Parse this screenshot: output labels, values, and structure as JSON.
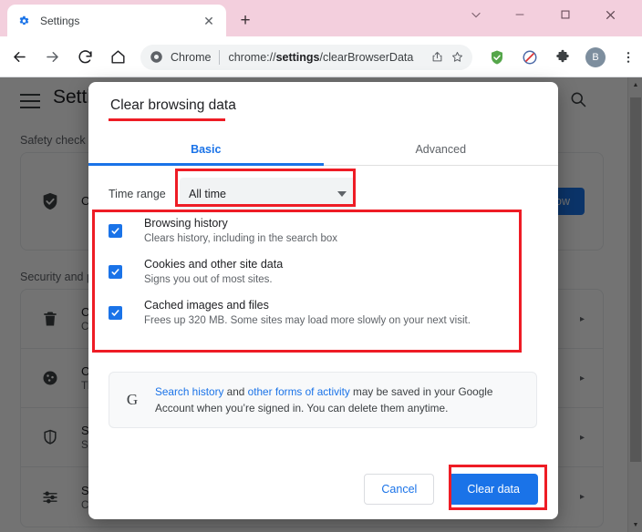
{
  "browser": {
    "tab": {
      "favicon": "gear-icon",
      "title": "Settings",
      "close": "✕"
    },
    "new_tab": "+",
    "window_controls": {
      "chevron": "⌄",
      "minimize": "–",
      "maximize": "□",
      "close": "✕"
    },
    "toolbar": {
      "back": "←",
      "forward": "→",
      "reload": "↻",
      "home": "⌂",
      "omnibox": {
        "site_icon": "chrome-icon",
        "site_label": "Chrome",
        "url_prefix": "chrome://",
        "url_bold": "settings",
        "url_suffix": "/clearBrowserData",
        "share": "share-icon",
        "bookmark": "☆"
      },
      "extensions": [
        {
          "name": "adguard-shield-icon",
          "color": "#55a64a"
        },
        {
          "name": "adblock-icon",
          "color": "#4e6ba8"
        },
        {
          "name": "puzzle-extensions-icon",
          "color": "#3c4043"
        }
      ],
      "avatar_letter": "B",
      "menu": "⋮"
    }
  },
  "settings_page": {
    "menu_button": "hamburger-icon",
    "heading": "Settings",
    "search": "search-icon",
    "sections": [
      {
        "label": "Safety check"
      },
      {
        "label": "Security and privacy"
      }
    ],
    "safety_card": {
      "icon": "safety-shield-icon",
      "title": "Chrome can help keep you safe from data breaches, bad extensions, and more",
      "button": "Check now"
    },
    "rows": [
      {
        "icon": "trash-icon",
        "title": "Clear browsing data",
        "sub": "Clear history, cookies, cache, and more",
        "arrow": "▸"
      },
      {
        "icon": "cookie-icon",
        "title": "Cookies and other site data",
        "sub": "Third-party cookies are blocked in Incognito mode",
        "arrow": "▸"
      },
      {
        "icon": "shield-icon",
        "title": "Security",
        "sub": "Safe Browsing (protection from dangerous sites) and other security settings",
        "arrow": "▸"
      },
      {
        "icon": "sliders-icon",
        "title": "Site Settings",
        "sub": "Controls what information sites can use and show",
        "arrow": "▸"
      }
    ],
    "scrollbar": {
      "up": "▲",
      "down": "▼"
    }
  },
  "dialog": {
    "title": "Clear browsing data",
    "tabs": [
      {
        "label": "Basic",
        "active": true
      },
      {
        "label": "Advanced",
        "active": false
      }
    ],
    "time_range": {
      "label": "Time range",
      "value": "All time",
      "caret": "caret-down-icon"
    },
    "checkboxes": [
      {
        "checked": true,
        "title": "Browsing history",
        "sub": "Clears history, including in the search box"
      },
      {
        "checked": true,
        "title": "Cookies and other site data",
        "sub": "Signs you out of most sites."
      },
      {
        "checked": true,
        "title": "Cached images and files",
        "sub": "Frees up 320 MB. Some sites may load more slowly on your next visit."
      }
    ],
    "google_note": {
      "icon": "google-g-icon",
      "link1": "Search history",
      "mid1": " and ",
      "link2": "other forms of activity",
      "rest": " may be saved in your Google Account when you’re signed in. You can delete them anytime."
    },
    "buttons": {
      "cancel": "Cancel",
      "confirm": "Clear data"
    }
  },
  "annotations": {
    "color": "#ee1c25",
    "targets": [
      "dialog-title-underline",
      "time-range-select",
      "checkbox-group",
      "clear-data-button"
    ]
  },
  "colors": {
    "accent_blue": "#1a73e8",
    "titlebar_pink": "#f3cfdd",
    "annotation_red": "#ee1c25",
    "scrim": "rgba(0,0,0,0.55)"
  }
}
